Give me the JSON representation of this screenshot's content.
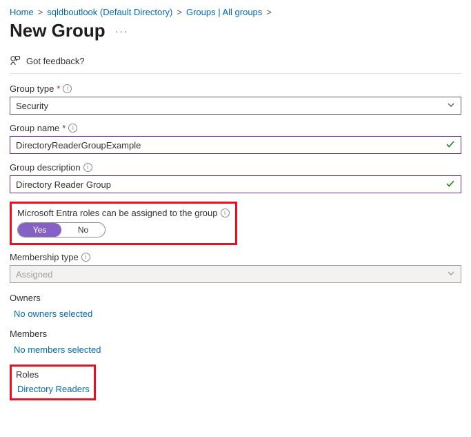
{
  "breadcrumb": {
    "home": "Home",
    "dir": "sqldboutlook (Default Directory)",
    "groups": "Groups | All groups"
  },
  "page": {
    "title": "New Group"
  },
  "feedback": {
    "label": "Got feedback?"
  },
  "fields": {
    "group_type": {
      "label": "Group type",
      "value": "Security"
    },
    "group_name": {
      "label": "Group name",
      "value": "DirectoryReaderGroupExample"
    },
    "group_desc": {
      "label": "Group description",
      "value": "Directory Reader Group"
    },
    "entra_roles": {
      "label": "Microsoft Entra roles can be assigned to the group",
      "yes": "Yes",
      "no": "No"
    },
    "membership_type": {
      "label": "Membership type",
      "value": "Assigned"
    }
  },
  "owners": {
    "heading": "Owners",
    "link": "No owners selected"
  },
  "members": {
    "heading": "Members",
    "link": "No members selected"
  },
  "roles": {
    "heading": "Roles",
    "link": "Directory Readers"
  }
}
